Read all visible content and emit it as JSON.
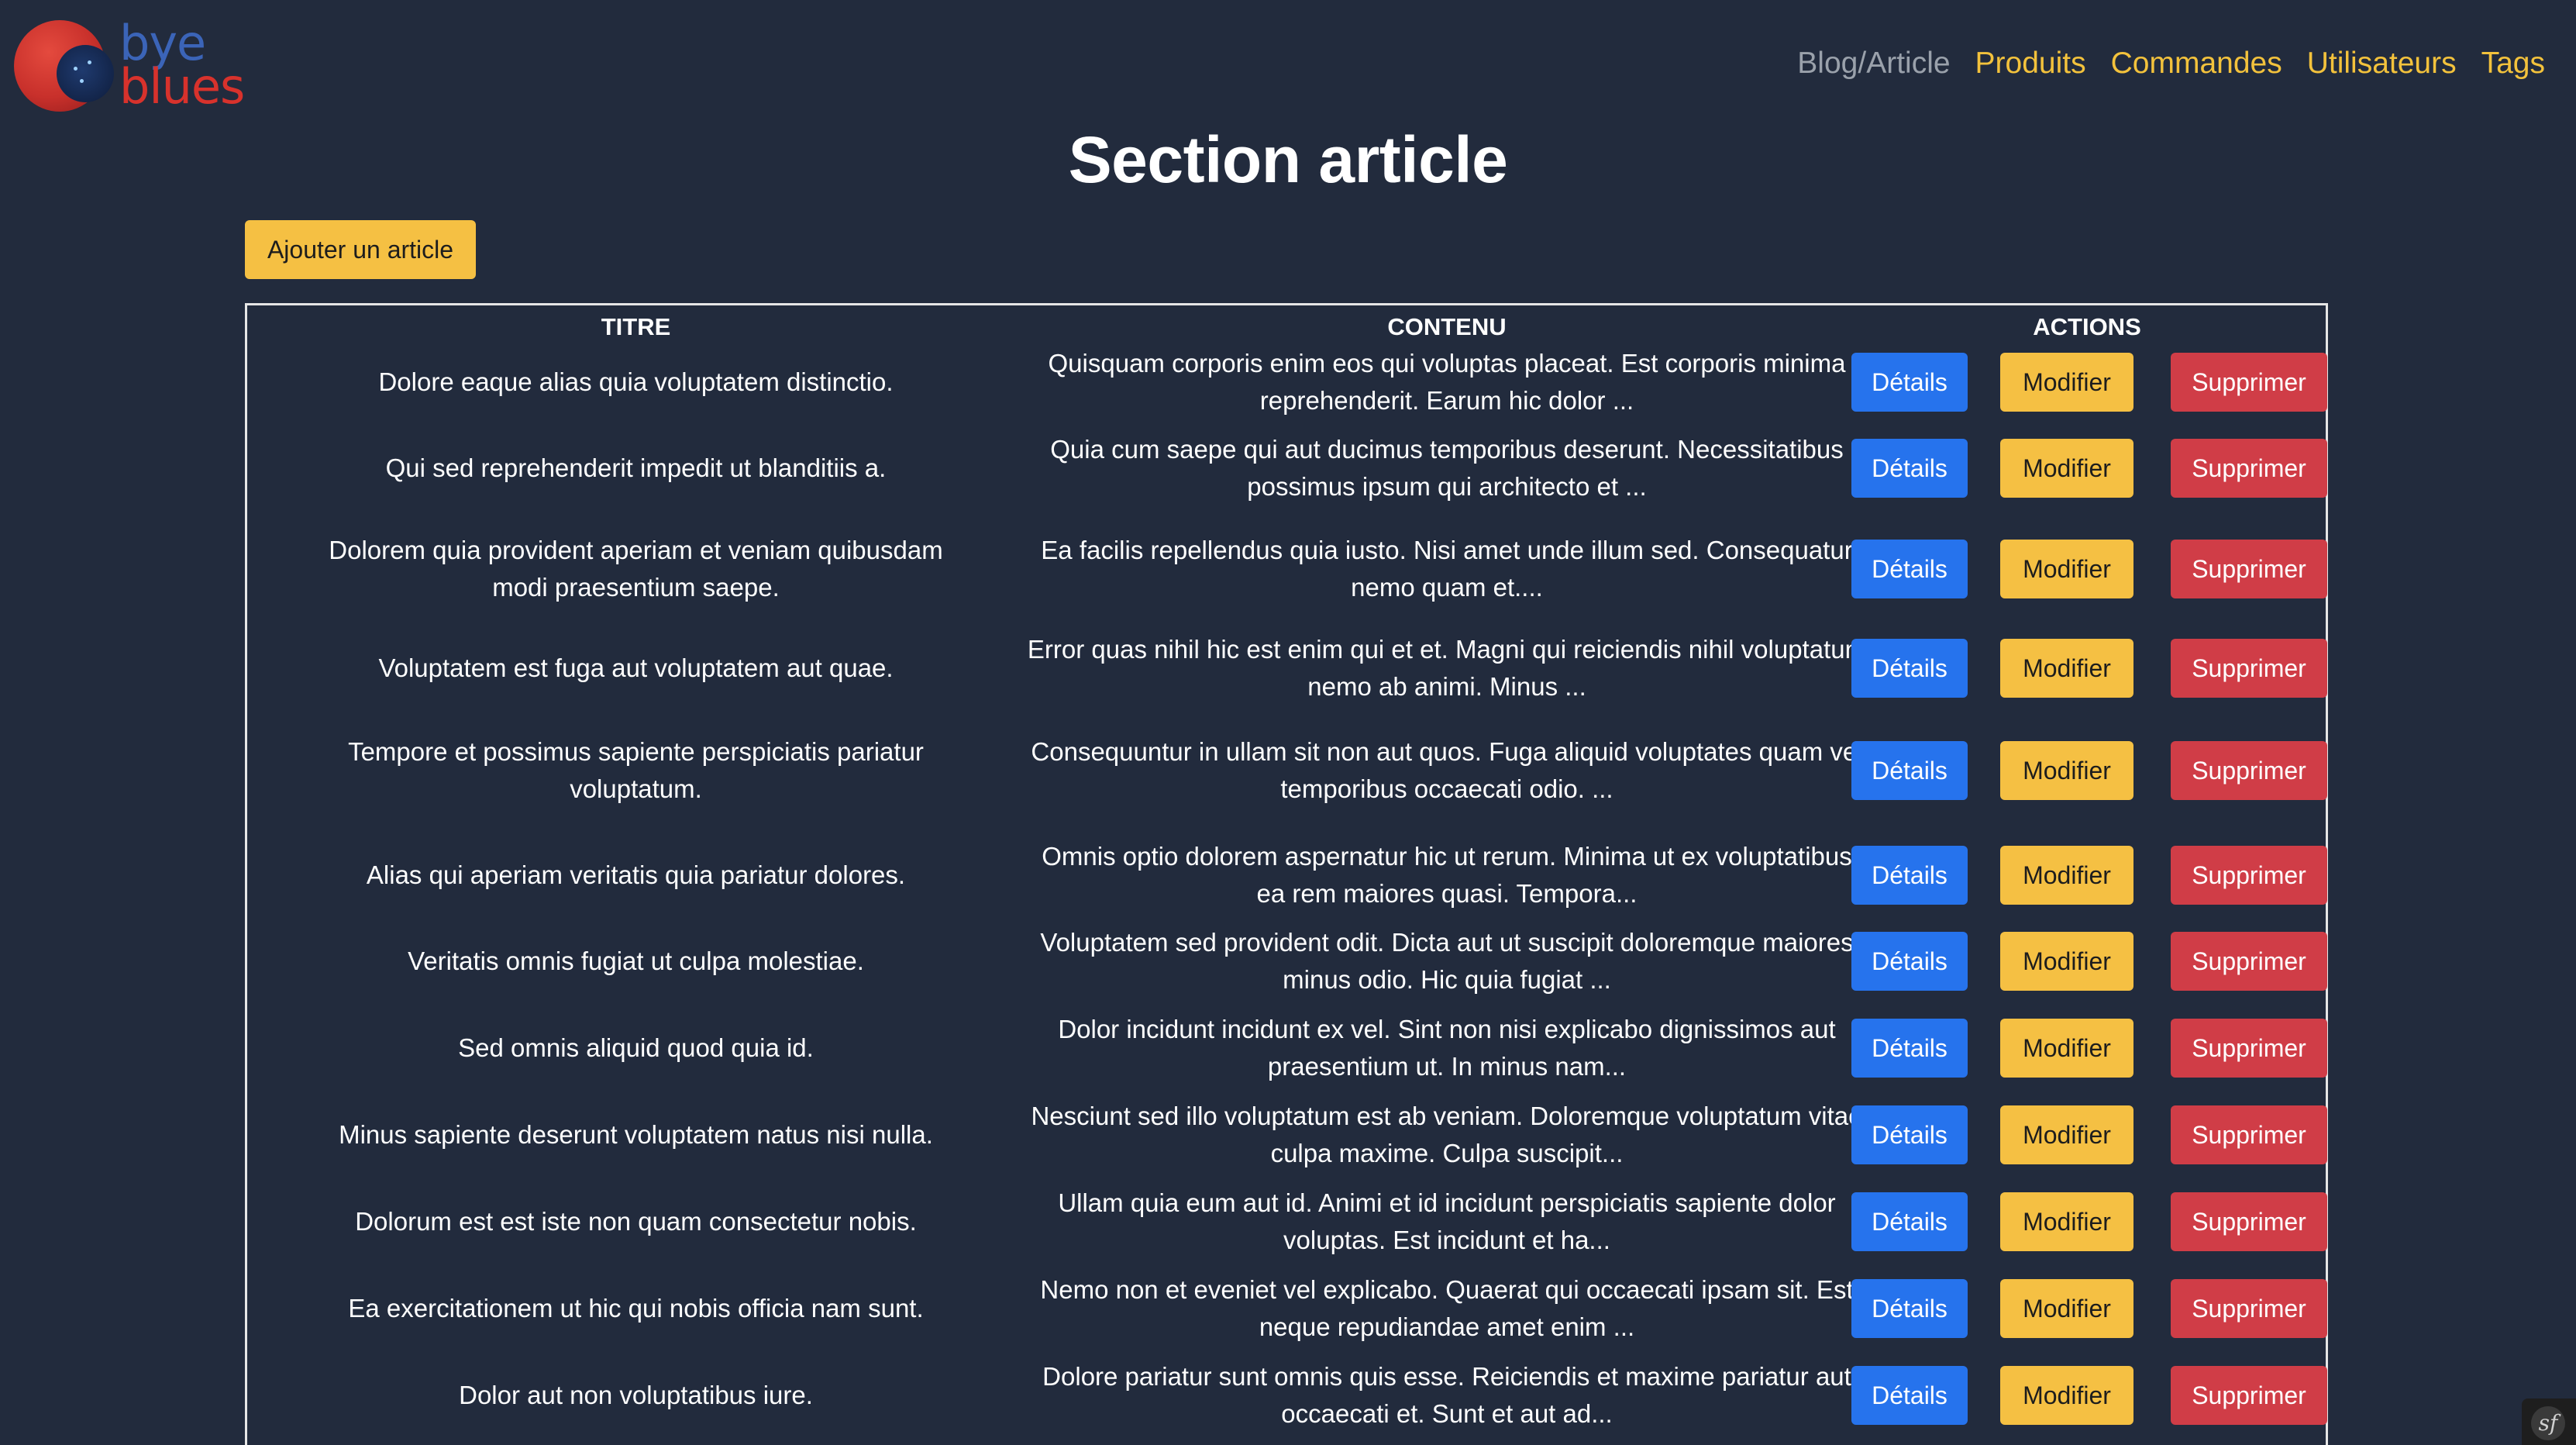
{
  "brand": {
    "word1": "bye",
    "word2": "blues"
  },
  "nav": {
    "items": [
      {
        "label": "Blog/Article"
      },
      {
        "label": "Produits"
      },
      {
        "label": "Commandes"
      },
      {
        "label": "Utilisateurs"
      },
      {
        "label": "Tags"
      }
    ]
  },
  "page": {
    "title": "Section article"
  },
  "toolbar": {
    "add_label": "Ajouter un article"
  },
  "table": {
    "headers": {
      "title": "TITRE",
      "content": "CONTENU",
      "actions": "ACTIONS"
    },
    "actions": {
      "details": "Détails",
      "edit": "Modifier",
      "delete": "Supprimer"
    },
    "rows": [
      {
        "title": "Dolore eaque alias quia voluptatem distinctio.",
        "content": "Quisquam corporis enim eos qui voluptas placeat. Est corporis minima reprehenderit. Earum hic dolor ..."
      },
      {
        "title": "Qui sed reprehenderit impedit ut blanditiis a.",
        "content": "Quia cum saepe qui aut ducimus temporibus deserunt. Necessitatibus possimus ipsum qui architecto et ..."
      },
      {
        "title": "Dolorem quia provident aperiam et veniam quibusdam modi praesentium saepe.",
        "content": "Ea facilis repellendus quia iusto. Nisi amet unde illum sed. Consequatur nemo quam et...."
      },
      {
        "title": "Voluptatem est fuga aut voluptatem aut quae.",
        "content": "Error quas nihil hic est enim qui et et. Magni qui reiciendis nihil voluptatum nemo ab animi. Minus ..."
      },
      {
        "title": "Tempore et possimus sapiente perspiciatis pariatur voluptatum.",
        "content": "Consequuntur in ullam sit non aut quos. Fuga aliquid voluptates quam vel temporibus occaecati odio. ..."
      },
      {
        "title": "Alias qui aperiam veritatis quia pariatur dolores.",
        "content": "Omnis optio dolorem aspernatur hic ut rerum. Minima ut ex voluptatibus ea rem maiores quasi. Tempora..."
      },
      {
        "title": "Veritatis omnis fugiat ut culpa molestiae.",
        "content": "Voluptatem sed provident odit. Dicta aut ut suscipit doloremque maiores minus odio. Hic quia fugiat ..."
      },
      {
        "title": "Sed omnis aliquid quod quia id.",
        "content": "Dolor incidunt incidunt ex vel. Sint non nisi explicabo dignissimos aut praesentium ut. In minus nam..."
      },
      {
        "title": "Minus sapiente deserunt voluptatem natus nisi nulla.",
        "content": "Nesciunt sed illo voluptatum est ab veniam. Doloremque voluptatum vitae culpa maxime. Culpa suscipit..."
      },
      {
        "title": "Dolorum est est iste non quam consectetur nobis.",
        "content": "Ullam quia eum aut id. Animi et id incidunt perspiciatis sapiente dolor voluptas. Est incidunt et ha..."
      },
      {
        "title": "Ea exercitationem ut hic qui nobis officia nam sunt.",
        "content": "Nemo non et eveniet vel explicabo. Quaerat qui occaecati ipsam sit. Est neque repudiandae amet enim ..."
      },
      {
        "title": "Dolor aut non voluptatibus iure.",
        "content": "Dolore pariatur sunt omnis quis esse. Reiciendis et maxime pariatur aut occaecati et. Sunt et aut ad..."
      }
    ]
  },
  "devtools": {
    "icon": "symfony-toolbar-icon",
    "glyph": "sf"
  },
  "colors": {
    "background": "#222b3d",
    "accent_yellow": "#f5c043",
    "nav_link": "#f3c23c",
    "nav_active": "#9aa1ab",
    "details_blue": "#2673ed",
    "delete_red": "#d03d47"
  }
}
